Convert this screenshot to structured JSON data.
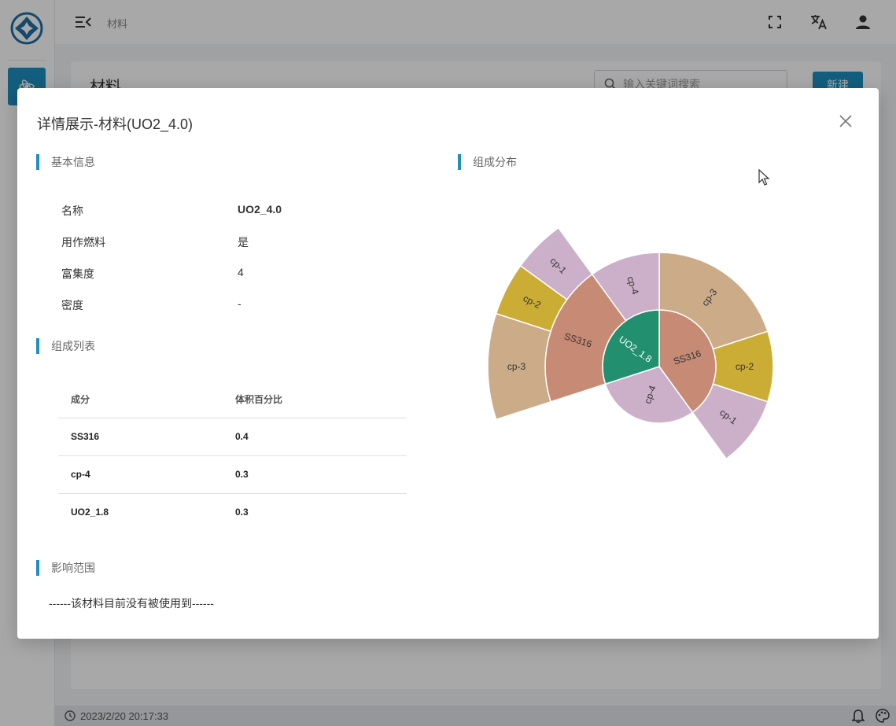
{
  "app": {
    "breadcrumb": "材料",
    "page_title": "材料",
    "search_placeholder": "输入关键词搜索",
    "new_button": "新建",
    "status_time": "2023/2/20 20:17:33",
    "brand_color": "#1e8fbf"
  },
  "modal": {
    "title": "详情展示-材料(UO2_4.0)",
    "basic_section": "基本信息",
    "basic": [
      {
        "label": "名称",
        "value": "UO2_4.0"
      },
      {
        "label": "用作燃料",
        "value": "是"
      },
      {
        "label": "富集度",
        "value": "4"
      },
      {
        "label": "密度",
        "value": "-"
      }
    ],
    "composition_section": "组成列表",
    "composition_headers": [
      "成分",
      "体积百分比"
    ],
    "composition_rows": [
      {
        "component": "SS316",
        "fraction": "0.4"
      },
      {
        "component": "cp-4",
        "fraction": "0.3"
      },
      {
        "component": "UO2_1.8",
        "fraction": "0.3"
      }
    ],
    "impact_section": "影响范围",
    "impact_text": "------该材料目前没有被使用到------",
    "chart_section": "组成分布"
  },
  "chart_data": {
    "type": "sunburst",
    "colors": {
      "SS316": "#c78a74",
      "UO2_1.8": "#22906e",
      "cp-4": "#ccafc9",
      "cp-3": "#cbab88",
      "cp-2": "#cbad35",
      "cp-1": "#ccafc9"
    },
    "nodes": [
      {
        "name": "UO2_1.8",
        "value": 0.3,
        "level": 1,
        "children": [
          {
            "name": "SS316",
            "value": 0.2,
            "level": 2,
            "children": [
              {
                "name": "cp-3",
                "value": 0.1,
                "level": 3
              },
              {
                "name": "cp-2",
                "value": 0.05,
                "level": 3
              },
              {
                "name": "cp-1",
                "value": 0.05,
                "level": 3
              }
            ]
          },
          {
            "name": "cp-4",
            "value": 0.1,
            "level": 2
          }
        ]
      },
      {
        "name": "SS316",
        "value": 0.4,
        "level": 1,
        "children": [
          {
            "name": "cp-3",
            "value": 0.2,
            "level": 2
          },
          {
            "name": "cp-2",
            "value": 0.1,
            "level": 2
          },
          {
            "name": "cp-1",
            "value": 0.1,
            "level": 2
          }
        ]
      },
      {
        "name": "cp-4",
        "value": 0.3,
        "level": 1
      }
    ]
  }
}
